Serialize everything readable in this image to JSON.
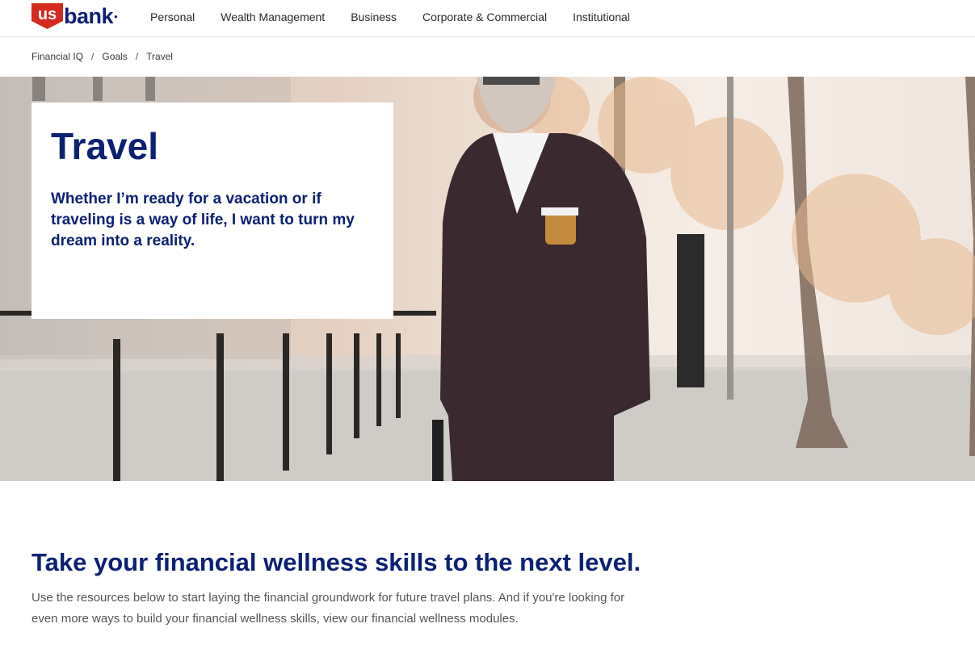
{
  "header": {
    "logo": {
      "shield_text": "us",
      "wordmark": "bank",
      "alt": "U.S. Bank"
    },
    "nav": [
      {
        "label": "Personal"
      },
      {
        "label": "Wealth Management"
      },
      {
        "label": "Business"
      },
      {
        "label": "Corporate & Commercial"
      },
      {
        "label": "Institutional"
      }
    ]
  },
  "breadcrumb": {
    "items": [
      "Financial IQ",
      "Goals",
      "Travel"
    ],
    "separator": "/"
  },
  "hero": {
    "title": "Travel",
    "description": "Whether I’m ready for a vacation or if traveling is a way of life, I want to turn my dream into a reality."
  },
  "section": {
    "title": "Take your financial wellness skills to the next level.",
    "body": "Use the resources below to start laying the financial groundwork for future travel plans. And if you're looking for even more ways to build your financial wellness skills, view our financial wellness modules."
  },
  "colors": {
    "brand_navy": "#0c2074",
    "brand_red": "#d52b1e",
    "body_text": "#555555"
  }
}
